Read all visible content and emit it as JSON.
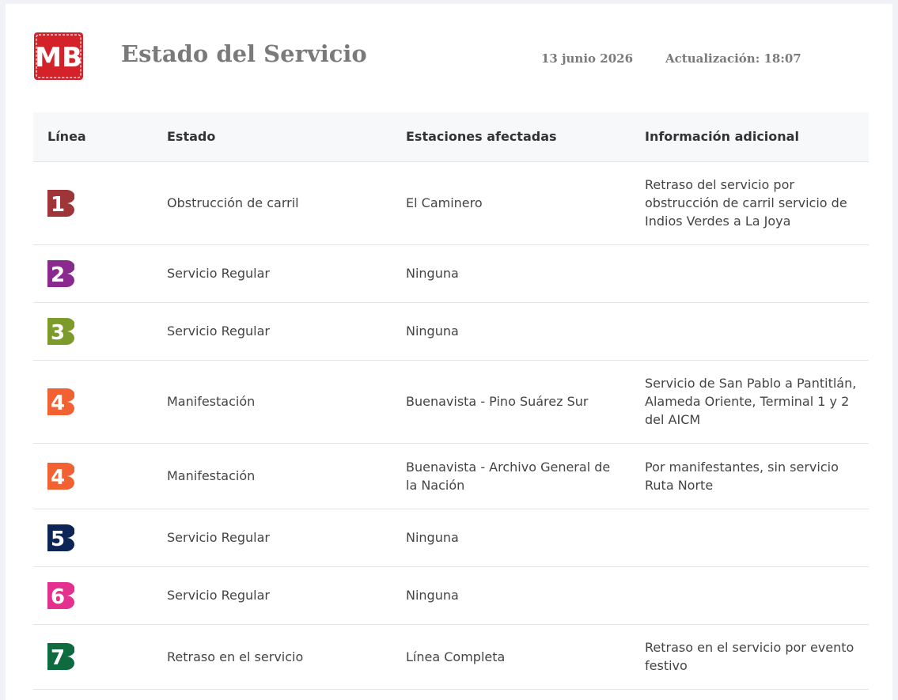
{
  "header": {
    "title": "Estado del Servicio",
    "date": "13 junio 2026",
    "update": "Actualización: 18:07",
    "logo_text": "MB",
    "logo_color": "#d3222a"
  },
  "table": {
    "columns": [
      "Línea",
      "Estado",
      "Estaciones afectadas",
      "Información adicional"
    ],
    "rows": [
      {
        "line": "1",
        "color": "#9e3539",
        "status": "Obstrucción de carril",
        "stations": "El Caminero",
        "info": "Retraso del servicio por obstrucción de carril servicio de Indios Verdes a La Joya"
      },
      {
        "line": "2",
        "color": "#8b2a8e",
        "status": "Servicio Regular",
        "stations": "Ninguna",
        "info": ""
      },
      {
        "line": "3",
        "color": "#7d9b2b",
        "status": "Servicio Regular",
        "stations": "Ninguna",
        "info": ""
      },
      {
        "line": "4",
        "color": "#f26131",
        "status": "Manifestación",
        "stations": "Buenavista - Pino Suárez Sur",
        "info": "Servicio de San Pablo a Pantitlán, Alameda Oriente, Terminal 1 y 2 del AICM"
      },
      {
        "line": "4",
        "color": "#f26131",
        "status": "Manifestación",
        "stations": "Buenavista - Archivo General de la Nación",
        "info": "Por manifestantes, sin servicio Ruta Norte"
      },
      {
        "line": "5",
        "color": "#0d2457",
        "status": "Servicio Regular",
        "stations": "Ninguna",
        "info": ""
      },
      {
        "line": "6",
        "color": "#e4308f",
        "status": "Servicio Regular",
        "stations": "Ninguna",
        "info": ""
      },
      {
        "line": "7",
        "color": "#0e6b3f",
        "status": "Retraso en el servicio",
        "stations": "Línea Completa",
        "info": "Retraso en el servicio por evento festivo"
      }
    ]
  }
}
